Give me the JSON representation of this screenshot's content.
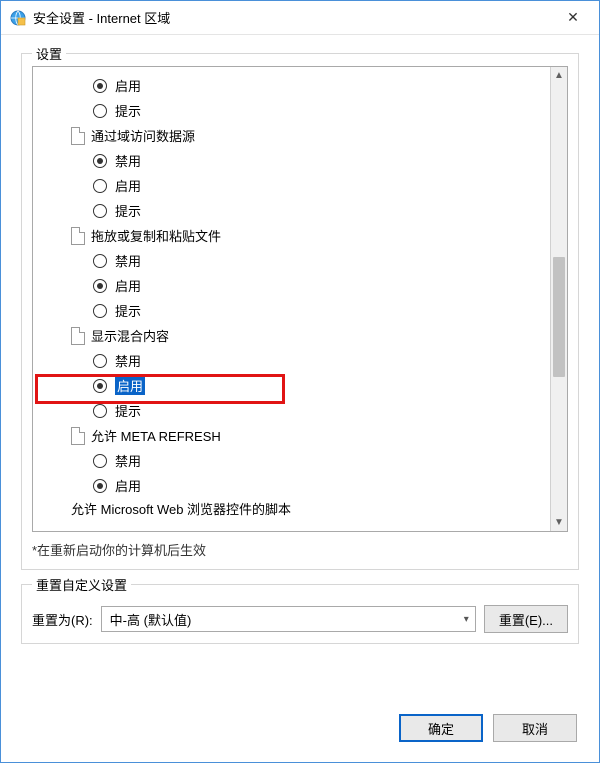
{
  "window": {
    "title": "安全设置 - Internet 区域",
    "close_glyph": "✕"
  },
  "groups": {
    "settings_label": "设置",
    "reset_label": "重置自定义设置"
  },
  "options": {
    "enable": "启用",
    "disable": "禁用",
    "prompt": "提示"
  },
  "categories": {
    "domain_access": "通过域访问数据源",
    "drag_copy_paste": "拖放或复制和粘贴文件",
    "mixed_content": "显示混合内容",
    "meta_refresh": "允许 META REFRESH",
    "truncated": "允许 Microsoft Web 浏览器控件的脚本"
  },
  "note": "*在重新启动你的计算机后生效",
  "reset": {
    "label": "重置为(R):",
    "combo_value": "中-高 (默认值)",
    "button": "重置(E)..."
  },
  "footer": {
    "ok": "确定",
    "cancel": "取消"
  },
  "scroll": {
    "up": "▲",
    "down": "▼"
  }
}
